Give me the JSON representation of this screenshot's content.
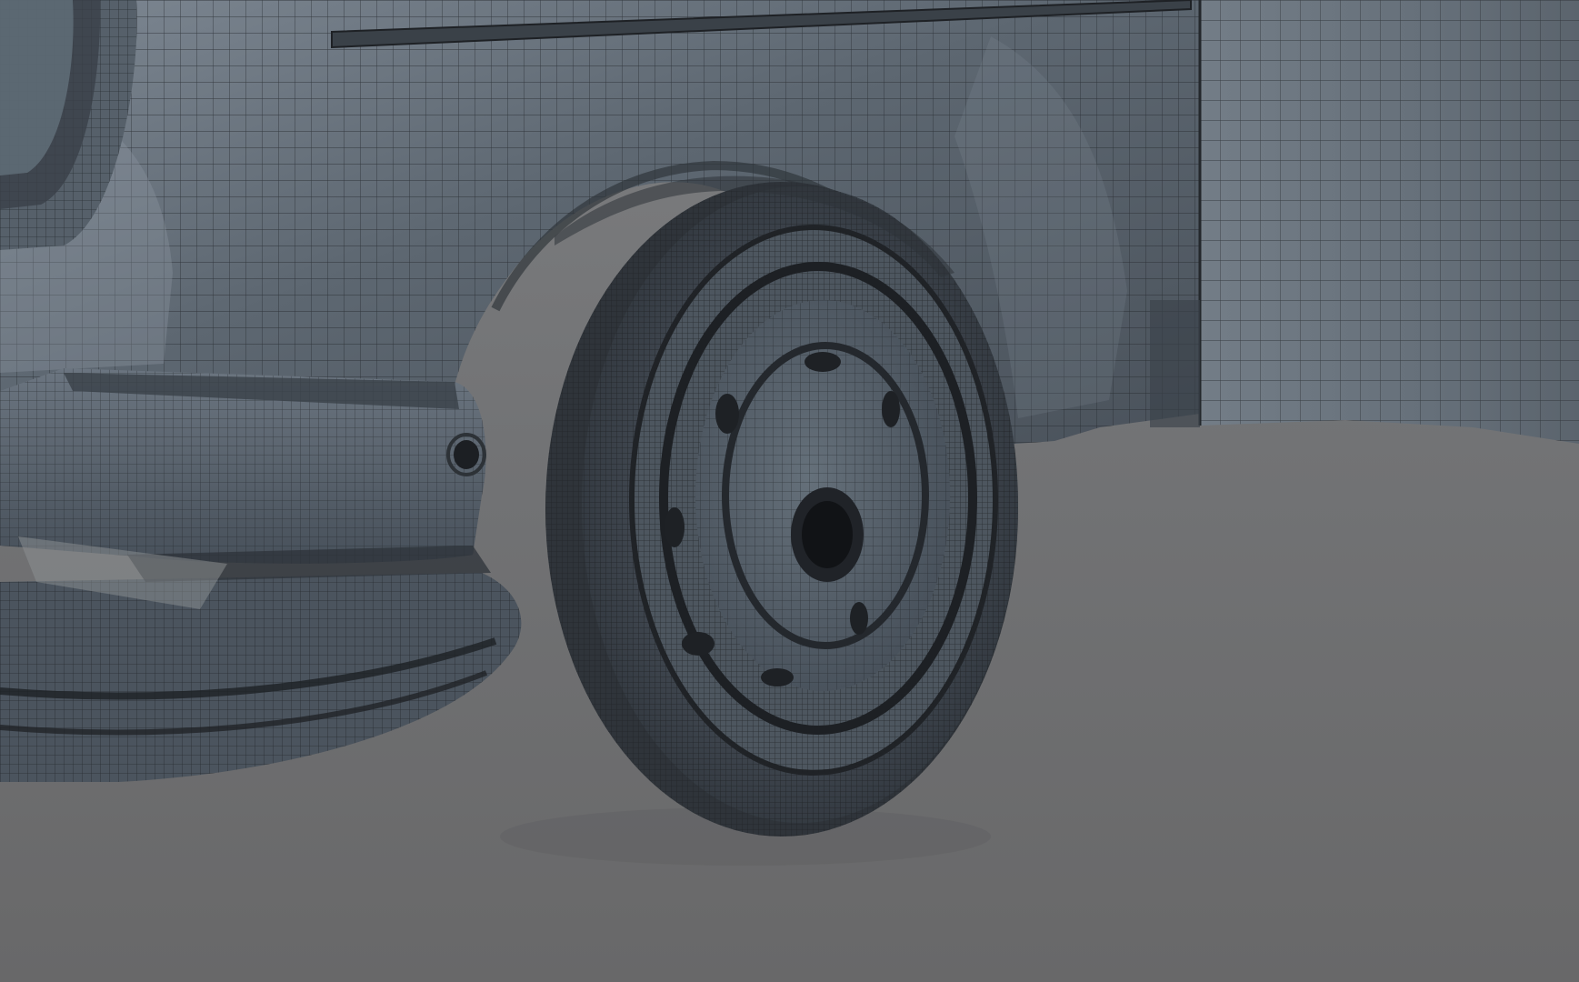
{
  "viewport": {
    "mode": "wireframe-on-shaded",
    "background_top": "#7f8082",
    "background_bottom": "#666768",
    "mesh_color": "#5f6974",
    "mesh_highlight": "#8d97a2",
    "wire_color": "#26292d",
    "objects": [
      "car-body",
      "front-wheel",
      "front-bumper",
      "fender",
      "door-panel",
      "headlight",
      "side-marker-light"
    ]
  }
}
